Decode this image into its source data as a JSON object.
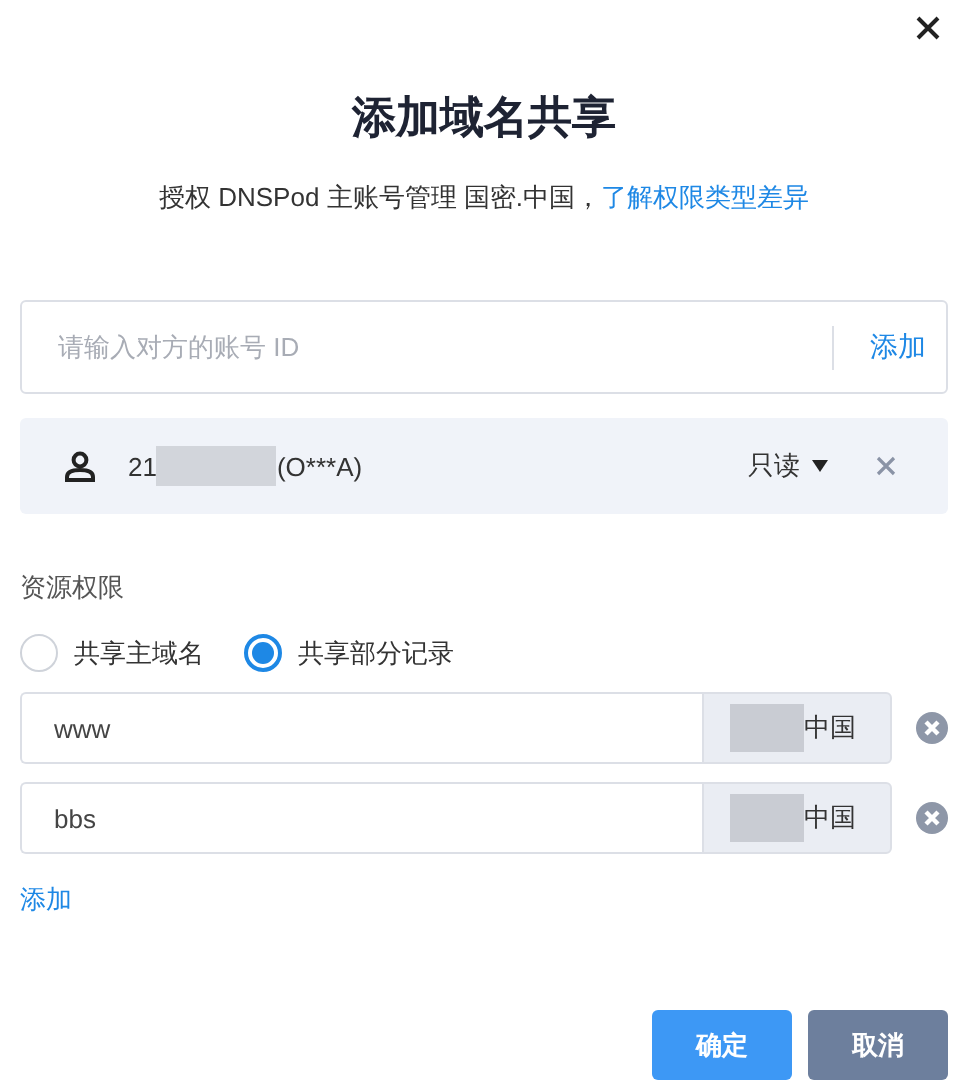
{
  "title": "添加域名共享",
  "subtitle": {
    "text": "授权 DNSPod 主账号管理 国密.中国，",
    "link": "了解权限类型差异"
  },
  "account_input": {
    "placeholder": "请输入对方的账号 ID",
    "add": "添加"
  },
  "member": {
    "id_prefix": "21",
    "name": "(O***A)",
    "permission": "只读"
  },
  "resource_label": "资源权限",
  "scope_options": [
    {
      "label": "共享主域名",
      "selected": false
    },
    {
      "label": "共享部分记录",
      "selected": true
    }
  ],
  "records": [
    {
      "value": "www",
      "suffix": "中国"
    },
    {
      "value": "bbs",
      "suffix": "中国"
    }
  ],
  "add_record": "添加",
  "buttons": {
    "confirm": "确定",
    "cancel": "取消"
  }
}
